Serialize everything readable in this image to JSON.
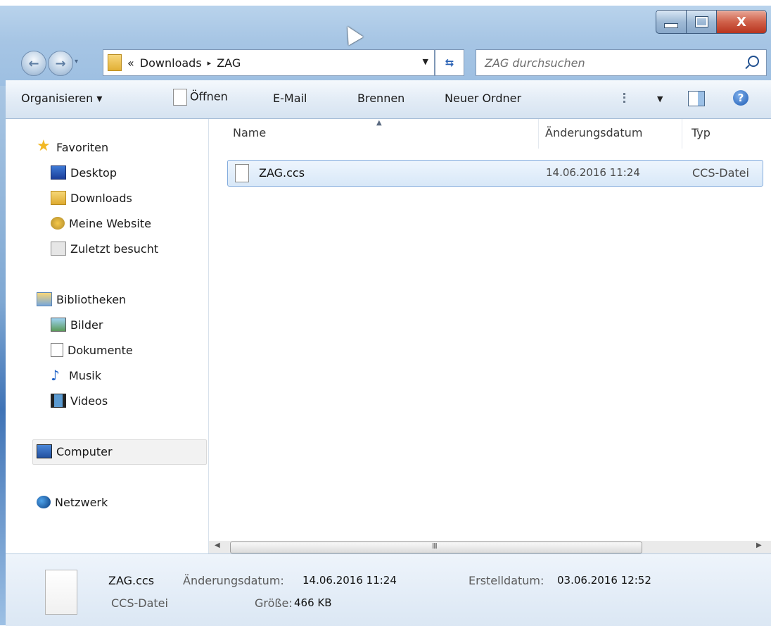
{
  "window": {
    "caption": {
      "minimize": "",
      "maximize": "",
      "close": "X"
    }
  },
  "navigation": {
    "address": {
      "prefix": "«",
      "crumbs": [
        "Downloads",
        "ZAG"
      ],
      "separator": "▸"
    },
    "search": {
      "placeholder": "ZAG durchsuchen"
    }
  },
  "toolbar": {
    "organize": "Organisieren ▾",
    "open": "Öffnen",
    "email": "E-Mail",
    "burn": "Brennen",
    "new_folder": "Neuer Ordner"
  },
  "sidebar": {
    "favorites": {
      "label": "Favoriten",
      "items": [
        "Desktop",
        "Downloads",
        "Meine Website",
        "Zuletzt besucht"
      ]
    },
    "libraries": {
      "label": "Bibliotheken",
      "items": [
        "Bilder",
        "Dokumente",
        "Musik",
        "Videos"
      ]
    },
    "computer": "Computer",
    "network": "Netzwerk"
  },
  "content": {
    "columns": [
      "Name",
      "Änderungsdatum",
      "Typ"
    ],
    "files": [
      {
        "name": "ZAG.ccs",
        "modified": "14.06.2016 11:24",
        "type": "CCS-Datei"
      }
    ]
  },
  "details": {
    "filename": "ZAG.ccs",
    "filetype": "CCS-Datei",
    "modified_label": "Änderungsdatum:",
    "modified_value": "14.06.2016 11:24",
    "created_label": "Erstelldatum:",
    "created_value": "03.06.2016 12:52",
    "size_label": "Größe:",
    "size_value": "466 KB"
  },
  "scrollbar": {
    "grip": "III"
  },
  "colors": {
    "accent": "#2b62b5",
    "selection": "#d8e8f8",
    "titlebar": "#a6c5e4"
  }
}
